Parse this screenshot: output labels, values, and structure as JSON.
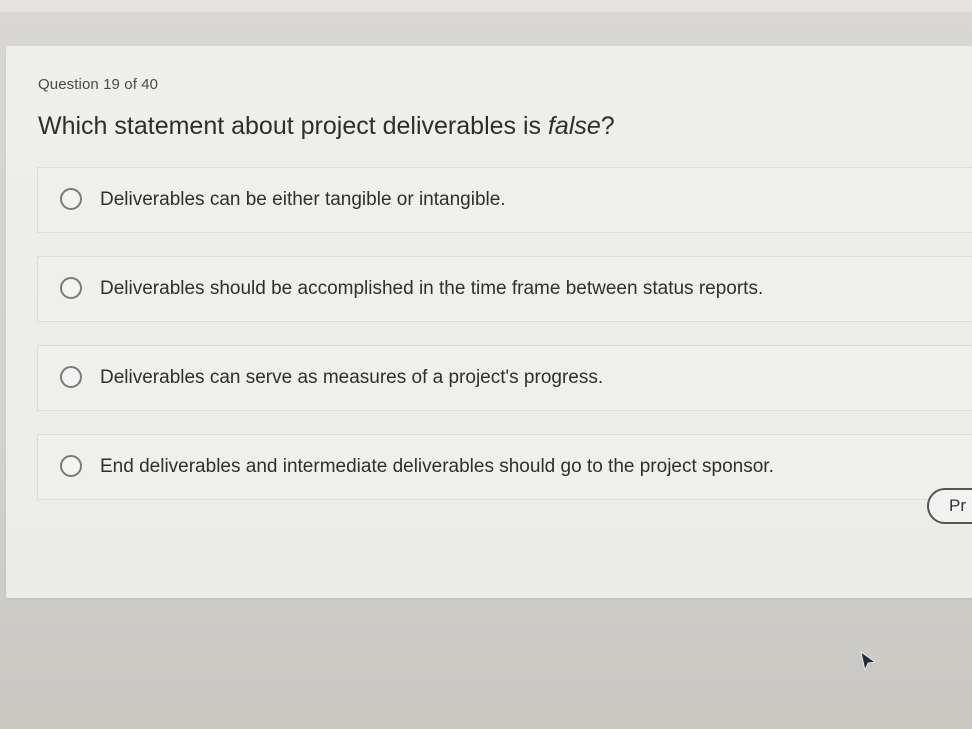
{
  "quiz": {
    "counter": "Question 19 of 40",
    "question_before": "Which statement about project deliverables is ",
    "question_emphasis": "false",
    "question_after": "?",
    "options": [
      {
        "label": "Deliverables can be either tangible or intangible."
      },
      {
        "label": "Deliverables should be accomplished in the time frame between status reports."
      },
      {
        "label": "Deliverables can serve as measures of a project's progress."
      },
      {
        "label": "End deliverables and intermediate deliverables should go to the project sponsor."
      }
    ],
    "next_button_label": "Pr"
  },
  "icons": {
    "option_selector": "radio-circle-icon",
    "pointer": "mouse-pointer-icon"
  }
}
